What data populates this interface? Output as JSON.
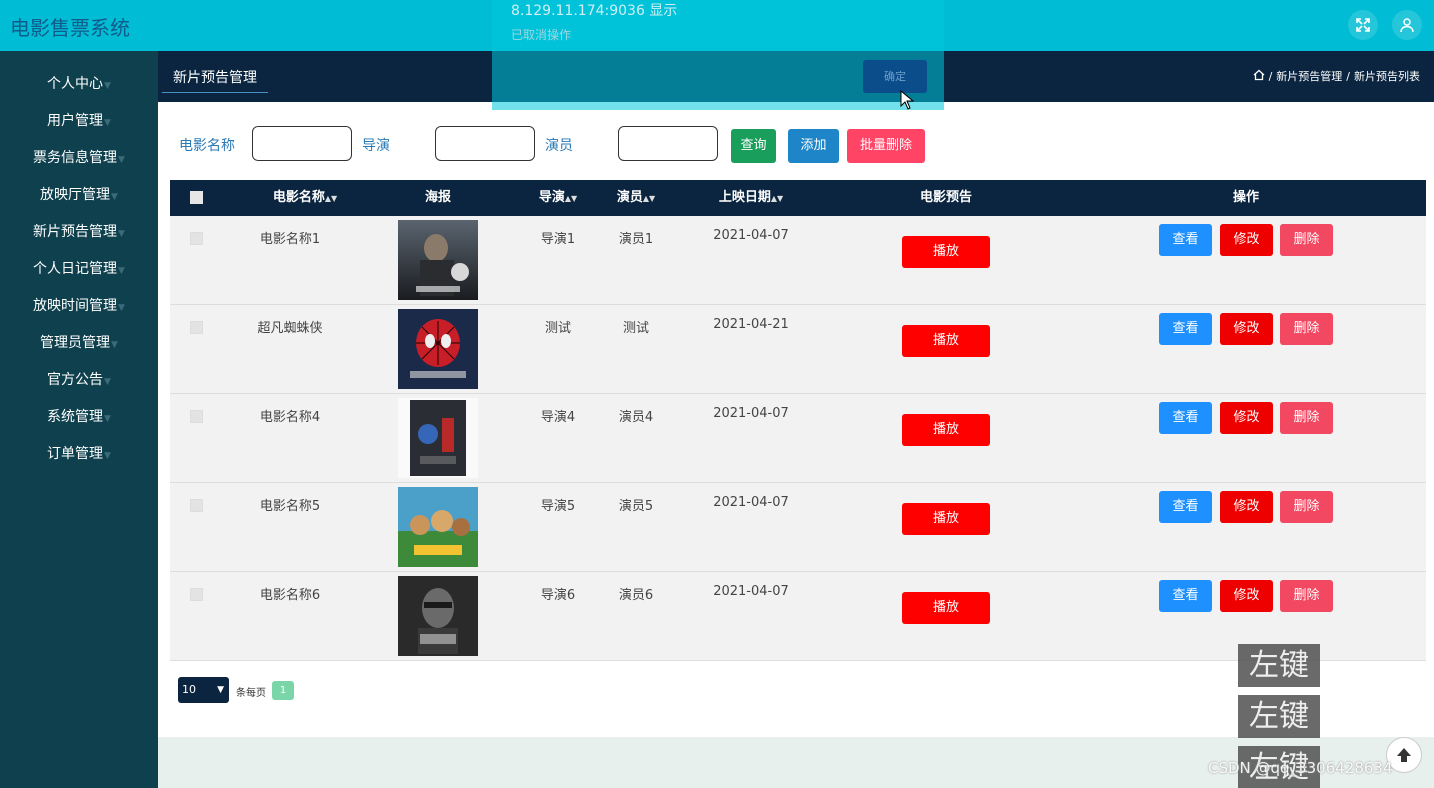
{
  "app": {
    "title": "电影售票系统"
  },
  "sidebar": {
    "items": [
      {
        "label": "个人中心"
      },
      {
        "label": "用户管理"
      },
      {
        "label": "票务信息管理"
      },
      {
        "label": "放映厅管理"
      },
      {
        "label": "新片预告管理"
      },
      {
        "label": "个人日记管理"
      },
      {
        "label": "放映时间管理"
      },
      {
        "label": "管理员管理"
      },
      {
        "label": "官方公告"
      },
      {
        "label": "系统管理"
      },
      {
        "label": "订单管理"
      }
    ]
  },
  "subheader": {
    "tab": "新片预告管理",
    "breadcrumb": [
      "新片预告管理",
      "新片预告列表"
    ]
  },
  "search": {
    "name_label": "电影名称",
    "director_label": "导演",
    "actor_label": "演员",
    "query_btn": "查询",
    "add_btn": "添加",
    "batch_delete_btn": "批量删除"
  },
  "table": {
    "headers": {
      "name": "电影名称",
      "poster": "海报",
      "director": "导演",
      "actor": "演员",
      "date": "上映日期",
      "trailer": "电影预告",
      "actions": "操作"
    },
    "rows": [
      {
        "name": "电影名称1",
        "director": "导演1",
        "actor": "演员1",
        "date": "2021-04-07",
        "play": "播放",
        "view": "查看",
        "edit": "修改",
        "delete": "删除"
      },
      {
        "name": "超凡蜘蛛侠",
        "director": "测试",
        "actor": "测试",
        "date": "2021-04-21",
        "play": "播放",
        "view": "查看",
        "edit": "修改",
        "delete": "删除"
      },
      {
        "name": "电影名称4",
        "director": "导演4",
        "actor": "演员4",
        "date": "2021-04-07",
        "play": "播放",
        "view": "查看",
        "edit": "修改",
        "delete": "删除"
      },
      {
        "name": "电影名称5",
        "director": "导演5",
        "actor": "演员5",
        "date": "2021-04-07",
        "play": "播放",
        "view": "查看",
        "edit": "修改",
        "delete": "删除"
      },
      {
        "name": "电影名称6",
        "director": "导演6",
        "actor": "演员6",
        "date": "2021-04-07",
        "play": "播放",
        "view": "查看",
        "edit": "修改",
        "delete": "删除"
      }
    ]
  },
  "pager": {
    "page_size": "10",
    "per_page_text": "条每页",
    "current_page": "1"
  },
  "dialog": {
    "title": "8.129.11.174:9036 显示",
    "message": "已取消操作",
    "ok": "确定"
  },
  "overlay": {
    "key_labels": [
      "左键",
      "左键",
      "左键"
    ],
    "watermark": "CSDN @qq_3306428634"
  },
  "colors": {
    "topbar": "#00bcd4",
    "sidebar": "#0f404e",
    "header": "#0b2540",
    "danger": "#ff0000",
    "primary": "#1e90ff"
  }
}
